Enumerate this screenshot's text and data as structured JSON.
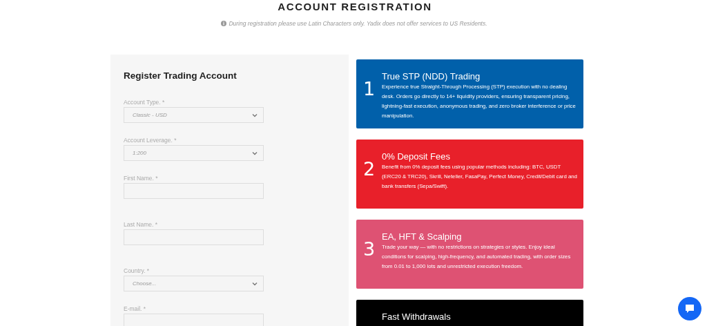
{
  "header": {
    "title": "ACCOUNT REGISTRATION",
    "note": "During registration please use Latin Characters only. Yadix does not offer services to US Residents."
  },
  "form": {
    "title": "Register Trading Account",
    "fields": [
      {
        "kind": "select",
        "label": "Account Type. *",
        "value": "Classic - USD"
      },
      {
        "kind": "select",
        "label": "Account Leverage. *",
        "value": "1:200"
      },
      {
        "kind": "text",
        "label": "First Name. *"
      },
      {
        "kind": "text",
        "label": "Last Name. *"
      },
      {
        "kind": "select",
        "label": "Country. *",
        "value": "Choose..."
      },
      {
        "kind": "text",
        "label": "E-mail. *"
      }
    ]
  },
  "features": [
    {
      "number": "1",
      "title": "True STP (NDD) Trading",
      "text": "Experience true Straight-Through Processing (STP) execution with no dealing desk. Orders go directly to 14+ liquidity providers, ensuring transparent pricing, lightning-fast execution, anonymous trading, and zero broker interference or price manipulation.",
      "color": "#0160aa"
    },
    {
      "number": "2",
      "title": "0% Deposit Fees",
      "text": "Benefit from 0% deposit fees using popular methods including: BTC, USDT (ERC20 & TRC20), Skrill, Neteller, FasaPay, Perfect Money, Credit/Debit card and bank transfers (Sepa/Swift).",
      "color": "#e8202a"
    },
    {
      "number": "3",
      "title": "EA, HFT & Scalping",
      "text": "Trade your way — with no restrictions on strategies or styles. Enjoy ideal conditions for scalping, high-frequency, and automated trading, with order sizes from 0.01 to 1,000 lots and unrestricted execution freedom.",
      "color": "#de5273"
    },
    {
      "title": "Fast Withdrawals",
      "color": "#000000"
    }
  ]
}
